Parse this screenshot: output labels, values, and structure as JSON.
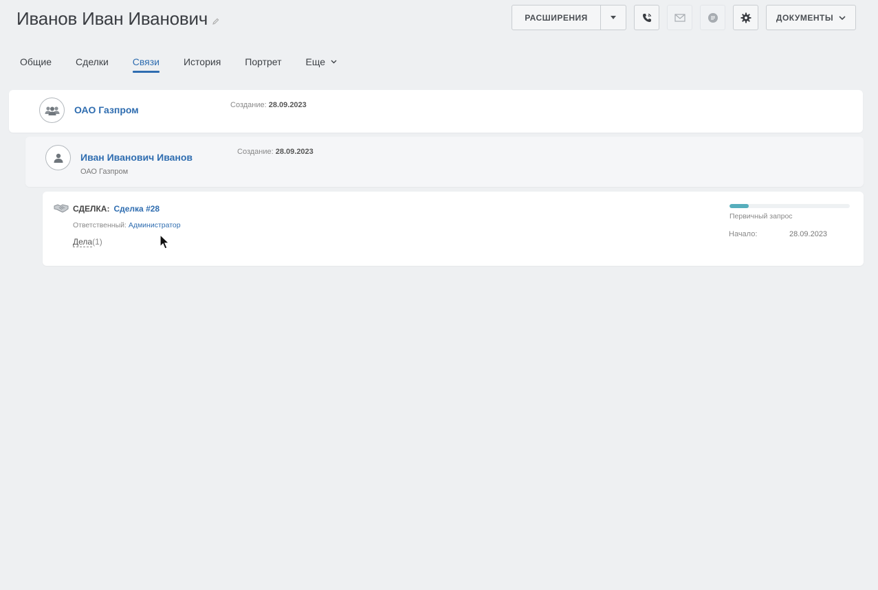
{
  "header": {
    "title": "Иванов Иван Иванович",
    "toolbar": {
      "extensions_label": "РАСШИРЕНИЯ",
      "documents_label": "ДОКУМЕНТЫ",
      "icons": [
        "phone-icon",
        "mail-icon",
        "chat-icon",
        "gear-icon"
      ]
    }
  },
  "tabs": [
    {
      "label": "Общие",
      "active": false
    },
    {
      "label": "Сделки",
      "active": false
    },
    {
      "label": "Связи",
      "active": true
    },
    {
      "label": "История",
      "active": false
    },
    {
      "label": "Портрет",
      "active": false
    },
    {
      "label": "Еще",
      "active": false,
      "dropdown": true
    }
  ],
  "relations": {
    "company": {
      "name": "ОАО Газпром",
      "created_label": "Создание:",
      "created_date": "28.09.2023",
      "icon": "group-icon"
    },
    "contact": {
      "name": "Иван Иванович Иванов",
      "company": "ОАО Газпром",
      "created_label": "Создание:",
      "created_date": "28.09.2023",
      "icon": "user-icon"
    },
    "deal": {
      "type_label": "СДЕЛКА:",
      "name": "Сделка #28",
      "responsible_label": "Ответственный:",
      "responsible": "Администратор",
      "tasks_label": "Дела",
      "tasks_count": "(1)",
      "stage": "Первичный запрос",
      "stage_progress": 0.16,
      "start_label": "Начало:",
      "start_date": "28.09.2023",
      "icon": "handshake-icon"
    }
  },
  "colors": {
    "accent": "#2f6db0",
    "progress": "#56aebc",
    "background": "#eef0f2"
  }
}
